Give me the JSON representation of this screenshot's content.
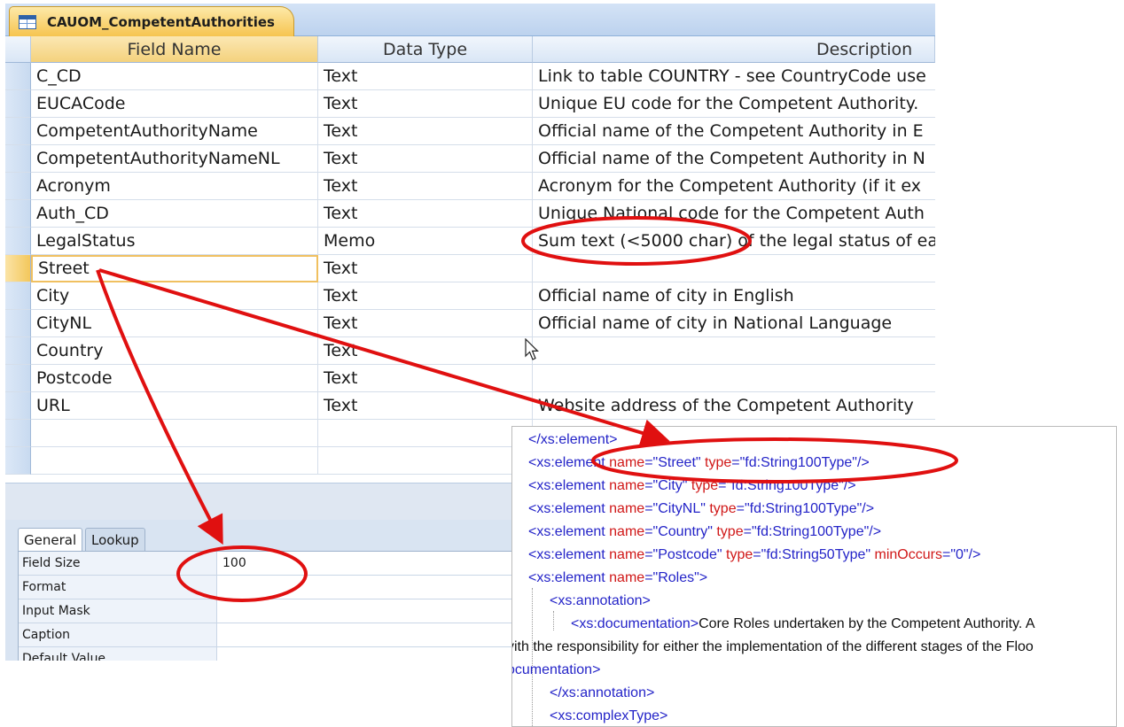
{
  "document_tab": {
    "title": "CAUOM_CompetentAuthorities",
    "icon": "table-icon"
  },
  "design_grid": {
    "columns": [
      "Field Name",
      "Data Type",
      "Description"
    ],
    "rows": [
      {
        "field": "C_CD",
        "type": "Text",
        "description": "Link to table COUNTRY - see CountryCode use"
      },
      {
        "field": "EUCACode",
        "type": "Text",
        "description": "Unique EU code for the Competent Authority."
      },
      {
        "field": "CompetentAuthorityName",
        "type": "Text",
        "description": "Official name of the Competent Authority in E"
      },
      {
        "field": "CompetentAuthorityNameNL",
        "type": "Text",
        "description": "Official name of the Competent Authority in N"
      },
      {
        "field": "Acronym",
        "type": "Text",
        "description": "Acronym for the Competent Authority (if it ex"
      },
      {
        "field": "Auth_CD",
        "type": "Text",
        "description": "Unique National code for the Competent Auth"
      },
      {
        "field": "LegalStatus",
        "type": "Memo",
        "description": "Sum text (<5000 char) of the legal status of ea"
      },
      {
        "field": "Street",
        "type": "Text",
        "description": ""
      },
      {
        "field": "City",
        "type": "Text",
        "description": "Official name of city in English"
      },
      {
        "field": "CityNL",
        "type": "Text",
        "description": "Official name of city in National Language"
      },
      {
        "field": "Country",
        "type": "Text",
        "description": ""
      },
      {
        "field": "Postcode",
        "type": "Text",
        "description": ""
      },
      {
        "field": "URL",
        "type": "Text",
        "description": "Website address of the Competent Authority"
      },
      {
        "field": "",
        "type": "",
        "description": ""
      },
      {
        "field": "",
        "type": "",
        "description": ""
      }
    ],
    "active_row": "Street"
  },
  "field_properties": {
    "tabs": [
      "General",
      "Lookup"
    ],
    "active_tab": "General",
    "rows": [
      {
        "label": "Field Size",
        "value": "100"
      },
      {
        "label": "Format",
        "value": ""
      },
      {
        "label": "Input Mask",
        "value": ""
      },
      {
        "label": "Caption",
        "value": ""
      },
      {
        "label": "Default Value",
        "value": ""
      }
    ]
  },
  "xml_schema": {
    "lines": [
      {
        "indent": 0,
        "parts": [
          {
            "cls": "tag",
            "t": "</xs:element>"
          }
        ]
      },
      {
        "indent": 0,
        "parts": [
          {
            "cls": "tag",
            "t": "<xs:element "
          },
          {
            "cls": "attr",
            "t": "name"
          },
          {
            "cls": "tag",
            "t": "=\"Street\" "
          },
          {
            "cls": "attr",
            "t": "type"
          },
          {
            "cls": "tag",
            "t": "=\"fd:String100Type\"/>"
          }
        ]
      },
      {
        "indent": 0,
        "parts": [
          {
            "cls": "tag",
            "t": "<xs:element "
          },
          {
            "cls": "attr",
            "t": "name"
          },
          {
            "cls": "tag",
            "t": "=\"City\" "
          },
          {
            "cls": "attr",
            "t": "type"
          },
          {
            "cls": "tag",
            "t": "=\"fd:String100Type\"/>"
          }
        ]
      },
      {
        "indent": 0,
        "parts": [
          {
            "cls": "tag",
            "t": "<xs:element "
          },
          {
            "cls": "attr",
            "t": "name"
          },
          {
            "cls": "tag",
            "t": "=\"CityNL\" "
          },
          {
            "cls": "attr",
            "t": "type"
          },
          {
            "cls": "tag",
            "t": "=\"fd:String100Type\"/>"
          }
        ]
      },
      {
        "indent": 0,
        "parts": [
          {
            "cls": "tag",
            "t": "<xs:element "
          },
          {
            "cls": "attr",
            "t": "name"
          },
          {
            "cls": "tag",
            "t": "=\"Country\" "
          },
          {
            "cls": "attr",
            "t": "type"
          },
          {
            "cls": "tag",
            "t": "=\"fd:String100Type\"/>"
          }
        ]
      },
      {
        "indent": 0,
        "parts": [
          {
            "cls": "tag",
            "t": "<xs:element "
          },
          {
            "cls": "attr",
            "t": "name"
          },
          {
            "cls": "tag",
            "t": "=\"Postcode\" "
          },
          {
            "cls": "attr",
            "t": "type"
          },
          {
            "cls": "tag",
            "t": "=\"fd:String50Type\" "
          },
          {
            "cls": "attr",
            "t": "minOccurs"
          },
          {
            "cls": "tag",
            "t": "=\"0\"/>"
          }
        ]
      },
      {
        "indent": 0,
        "parts": [
          {
            "cls": "tag",
            "t": "<xs:element "
          },
          {
            "cls": "attr",
            "t": "name"
          },
          {
            "cls": "tag",
            "t": "=\"Roles\">"
          }
        ]
      },
      {
        "indent": 1,
        "parts": [
          {
            "cls": "tag",
            "t": "<xs:annotation>"
          }
        ]
      },
      {
        "indent": 2,
        "parts": [
          {
            "cls": "tag",
            "t": "<xs:documentation>"
          },
          {
            "cls": "txt",
            "t": "Core Roles undertaken by the Competent Authority. A"
          }
        ]
      },
      {
        "indent": -1,
        "parts": [
          {
            "cls": "txt",
            "t": "vith the responsibility for either the implementation of the different stages of the Floo"
          }
        ]
      },
      {
        "indent": -1,
        "parts": [
          {
            "cls": "tag",
            "t": "ocumentation>"
          }
        ]
      },
      {
        "indent": 1,
        "parts": [
          {
            "cls": "tag",
            "t": "</xs:annotation>"
          }
        ]
      },
      {
        "indent": 1,
        "parts": [
          {
            "cls": "tag",
            "t": "<xs:complexType>"
          }
        ]
      }
    ]
  },
  "annotation_color": "#e01010"
}
